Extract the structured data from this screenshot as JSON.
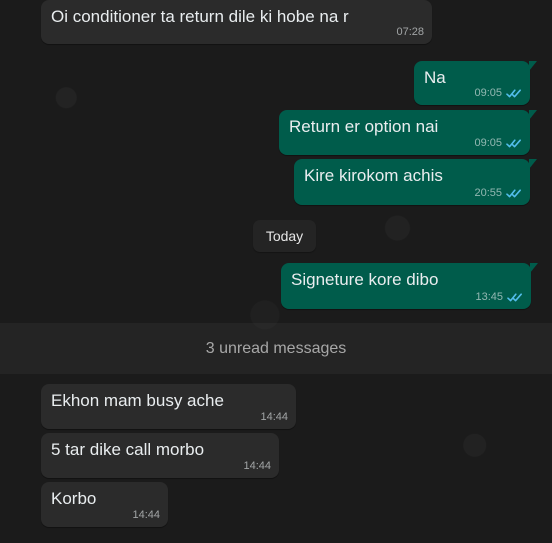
{
  "chat": {
    "date_separator": "Today",
    "unread_label": "3 unread messages",
    "messages": [
      {
        "text": "Oi conditioner ta return dile ki hobe na r",
        "time": "07:28",
        "direction": "incoming",
        "status_icon": ""
      },
      {
        "text": "Na",
        "time": "09:05",
        "direction": "outgoing",
        "status_icon": "double-check-read-icon"
      },
      {
        "text": "Return er option nai",
        "time": "09:05",
        "direction": "outgoing",
        "status_icon": "double-check-read-icon"
      },
      {
        "text": "Kire kirokom achis",
        "time": "20:55",
        "direction": "outgoing",
        "status_icon": "double-check-read-icon"
      },
      {
        "text": "Signeture kore dibo",
        "time": "13:45",
        "direction": "outgoing",
        "status_icon": "double-check-read-icon"
      },
      {
        "text": "Ekhon mam busy ache",
        "time": "14:44",
        "direction": "incoming",
        "status_icon": ""
      },
      {
        "text": "5 tar dike call morbo",
        "time": "14:44",
        "direction": "incoming",
        "status_icon": ""
      },
      {
        "text": "Korbo",
        "time": "14:44",
        "direction": "incoming",
        "status_icon": ""
      }
    ]
  },
  "colors": {
    "background": "#1b1b1b",
    "incoming_bubble": "#2b2b2b",
    "outgoing_bubble": "#005c4b",
    "read_tick": "#53bdeb",
    "text": "#e9edef"
  }
}
